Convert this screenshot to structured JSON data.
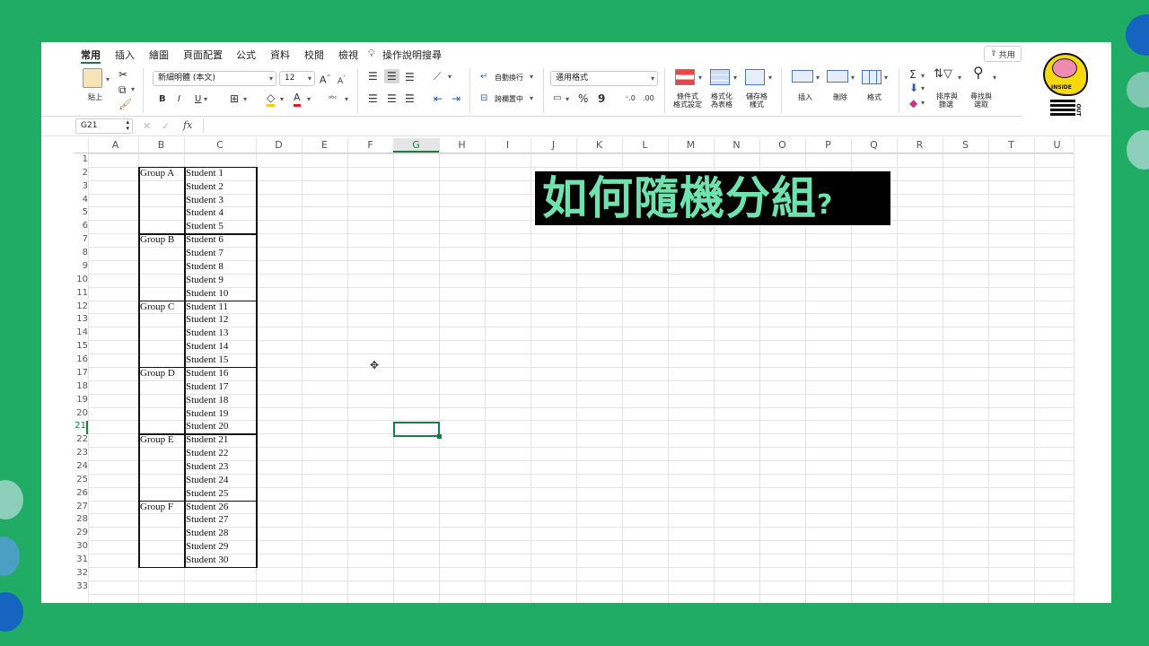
{
  "tabs": [
    "常用",
    "插入",
    "繪圖",
    "頁面配置",
    "公式",
    "資料",
    "校閱",
    "檢視"
  ],
  "tell_me": "操作說明搜尋",
  "share_label": "共用",
  "ribbon": {
    "paste_label": "貼上",
    "font_name": "新細明體 (本文)",
    "font_size": "12",
    "bold": "B",
    "italic": "I",
    "underline": "U",
    "wrap_text": "自動換行",
    "merge_center": "跨欄置中",
    "number_format": "通用格式",
    "conditional_format": [
      "條件式",
      "格式設定"
    ],
    "format_as_table": [
      "格式化",
      "為表格"
    ],
    "cell_styles": [
      "儲存格",
      "樣式"
    ],
    "insert": "插入",
    "delete": "刪除",
    "format": "格式",
    "sort_filter": [
      "排序與",
      "篩選"
    ],
    "find_select": [
      "尋找與",
      "選取"
    ],
    "percent": "%",
    "comma": "9"
  },
  "formula_bar": {
    "name_box": "G21",
    "fx": "fx"
  },
  "columns": [
    "A",
    "B",
    "C",
    "D",
    "E",
    "F",
    "G",
    "H",
    "I",
    "J",
    "K",
    "L",
    "M",
    "N",
    "O",
    "P",
    "Q",
    "R",
    "S",
    "T",
    "U"
  ],
  "rows": [
    "1",
    "2",
    "3",
    "4",
    "5",
    "6",
    "7",
    "8",
    "9",
    "10",
    "11",
    "12",
    "13",
    "14",
    "15",
    "16",
    "17",
    "18",
    "19",
    "20",
    "21",
    "22",
    "23",
    "24",
    "25",
    "26",
    "27",
    "28",
    "29",
    "30",
    "31",
    "32",
    "33"
  ],
  "groups": [
    {
      "name": "Group A",
      "students": [
        "Student 1",
        "Student 2",
        "Student 3",
        "Student 4",
        "Student 5"
      ]
    },
    {
      "name": "Group B",
      "students": [
        "Student 6",
        "Student 7",
        "Student 8",
        "Student 9",
        "Student 10"
      ]
    },
    {
      "name": "Group C",
      "students": [
        "Student 11",
        "Student 12",
        "Student 13",
        "Student 14",
        "Student 15"
      ]
    },
    {
      "name": "Group D",
      "students": [
        "Student 16",
        "Student 17",
        "Student 18",
        "Student 19",
        "Student 20"
      ]
    },
    {
      "name": "Group E",
      "students": [
        "Student 21",
        "Student 22",
        "Student 23",
        "Student 24",
        "Student 25"
      ]
    },
    {
      "name": "Group F",
      "students": [
        "Student 26",
        "Student 27",
        "Student 28",
        "Student 29",
        "Student 30"
      ]
    }
  ],
  "overlay_title": "如何隨機分組",
  "overlay_title_mark": "?",
  "selected_cell": "G21",
  "logo": {
    "text_top": "INSIDE",
    "text_side": "OUT"
  },
  "colors": {
    "background": "#21ac66",
    "title_text": "#6fe3ad",
    "selection": "#1f7a45"
  }
}
